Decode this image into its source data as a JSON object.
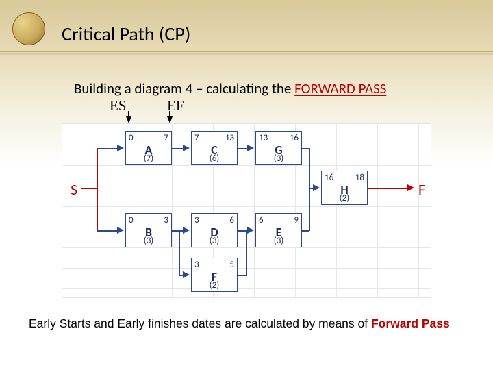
{
  "title": "Critical Path (CP)",
  "subtitle_prefix": "Building a diagram 4 – calculating the ",
  "subtitle_highlight": "FORWARD PASS",
  "es_label": "ES",
  "ef_label": "EF",
  "start_label": "S",
  "finish_label": "F",
  "nodes": {
    "A": {
      "name": "A",
      "es": "0",
      "ef": "7",
      "dur": "(7)"
    },
    "B": {
      "name": "B",
      "es": "0",
      "ef": "3",
      "dur": "(3)"
    },
    "C": {
      "name": "C",
      "es": "7",
      "ef": "13",
      "dur": "(6)"
    },
    "D": {
      "name": "D",
      "es": "3",
      "ef": "6",
      "dur": "(3)"
    },
    "E": {
      "name": "E",
      "es": "6",
      "ef": "9",
      "dur": "(3)"
    },
    "F": {
      "name": "F",
      "es": "3",
      "ef": "5",
      "dur": "(2)"
    },
    "G": {
      "name": "G",
      "es": "13",
      "ef": "16",
      "dur": "(3)"
    },
    "H": {
      "name": "H",
      "es": "16",
      "ef": "18",
      "dur": "(2)"
    }
  },
  "footnote_prefix": "Early Starts and Early finishes  dates are calculated by means of ",
  "footnote_highlight": "Forward Pass"
}
